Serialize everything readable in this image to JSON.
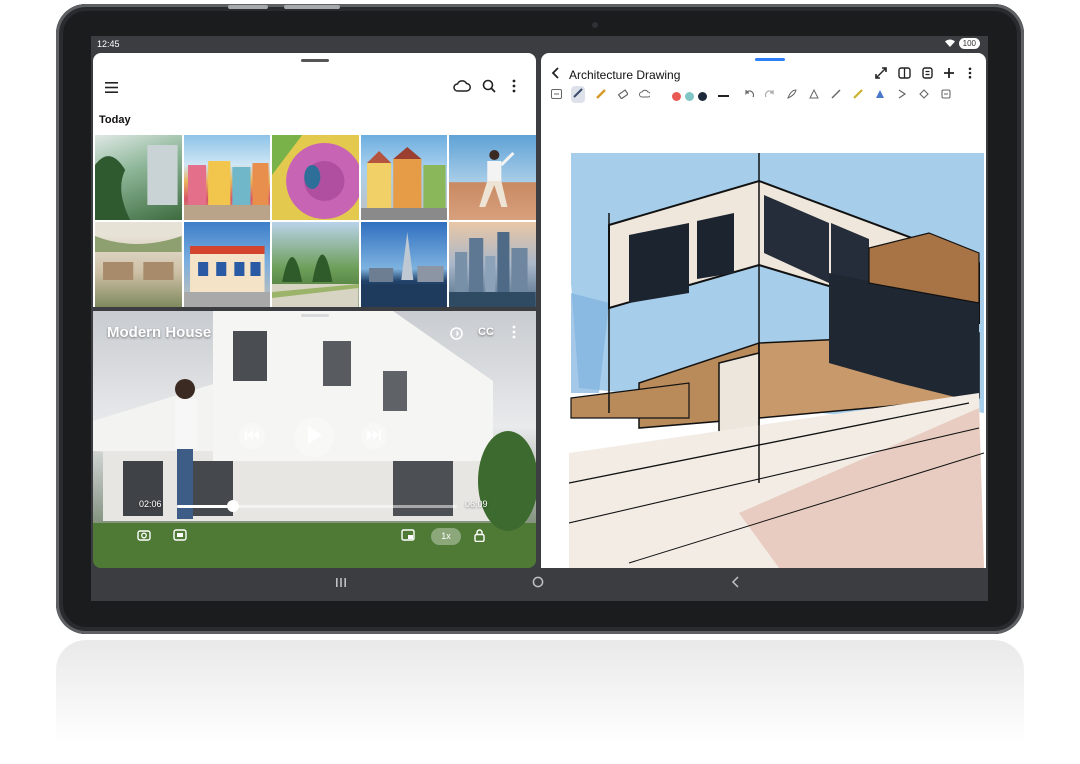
{
  "status_bar": {
    "time": "12:45",
    "battery": "100"
  },
  "gallery": {
    "section_label": "Today",
    "icons": {
      "menu": "hamburger-icon",
      "cloud": "cloud-icon",
      "search": "search-icon",
      "more": "more-vertical-icon"
    }
  },
  "video": {
    "title": "Modern House",
    "current_time": "02:06",
    "end_time": "06:09",
    "cc_label": "CC",
    "speed_label": "1x",
    "progress_fraction": 0.2
  },
  "notes": {
    "title": "Architecture Drawing",
    "pen_colors": [
      "#e85a52",
      "#7fc6c4",
      "#1e2a3a"
    ]
  },
  "colors": {
    "accent": "#2d7ff9"
  }
}
